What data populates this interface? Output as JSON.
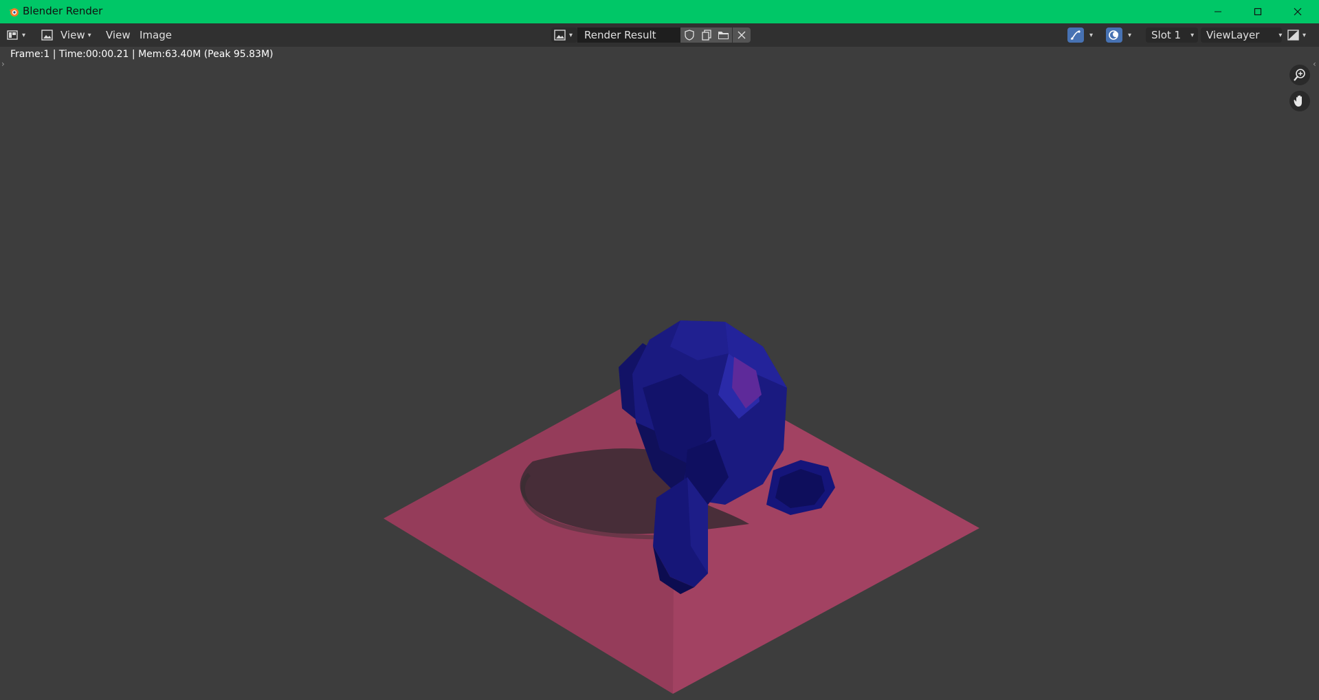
{
  "window": {
    "title": "Blender Render",
    "icon": "blender-icon",
    "controls": [
      "minimize-icon",
      "maximize-icon",
      "close-icon"
    ]
  },
  "header": {
    "editor_type_icon": "image-editor-icon",
    "mode_icon": "image-mode-icon",
    "mode_label": "View",
    "menus": [
      "View",
      "Image"
    ],
    "image_name": "Render Result",
    "image_tools": [
      "fake-user-shield-icon",
      "new-image-icon",
      "open-folder-icon",
      "unlink-x-icon"
    ],
    "toggles": [
      "curve-scopes-icon",
      "gizmo-overlay-icon"
    ],
    "slot": "Slot 1",
    "view_layer": "ViewLayer",
    "display_icon": "display-channels-icon"
  },
  "stats": {
    "text": "Frame:1 | Time:00:00.21 | Mem:63.40M (Peak 95.83M)"
  },
  "viewport": {
    "nav_icons": [
      "zoom-icon",
      "hand-pan-icon"
    ],
    "render_subject": "suzanne-monkey-on-plane",
    "colors": {
      "background": "#3d3d3d",
      "plane": "#a24262",
      "monkey": "#1a1a7a",
      "shadow": "#2c2c2c",
      "accent": "#4772b3",
      "titlebar": "#00c767"
    }
  }
}
